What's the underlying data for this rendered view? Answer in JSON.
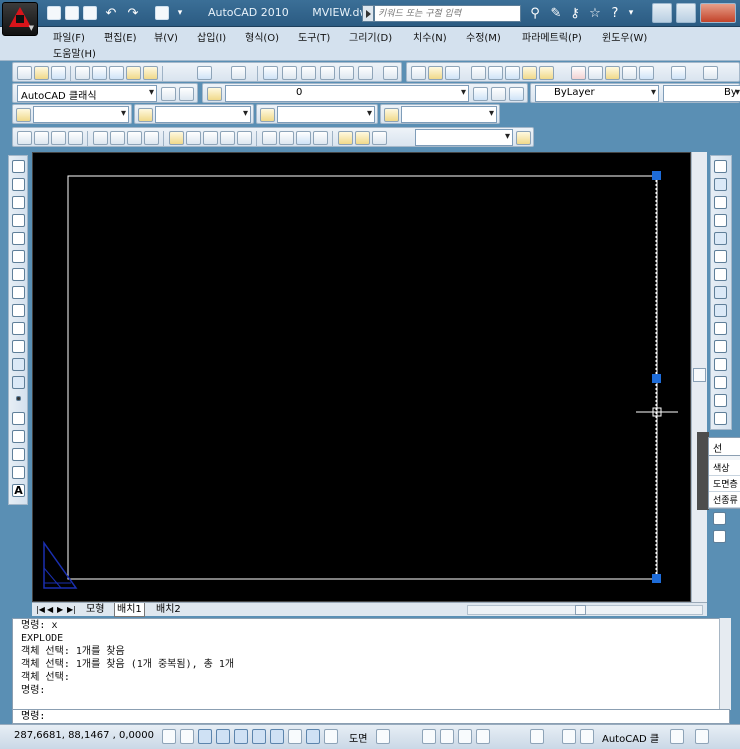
{
  "window": {
    "app_name": "AutoCAD 2010",
    "file_name": "MVIEW.dwg",
    "search_placeholder": "키워드 또는 구절 입력"
  },
  "menu": {
    "row1": [
      "파일(F)",
      "편집(E)",
      "뷰(V)",
      "삽입(I)",
      "형식(O)",
      "도구(T)",
      "그리기(D)",
      "치수(N)",
      "수정(M)",
      "파라메트릭(P)",
      "윈도우(W)"
    ],
    "row2": [
      "도움말(H)"
    ]
  },
  "toolbars": {
    "workspace": "AutoCAD 클래식",
    "layer": "0",
    "color": "ByLayer",
    "linetype": "By"
  },
  "tabs": {
    "model": "모형",
    "layout1": "배치1",
    "layout2": "배치2"
  },
  "command": {
    "history": [
      "명령: x",
      "EXPLODE",
      "객체 선택: 1개를 찾음",
      "객체 선택: 1개를 찾음 (1개 중복됨), 총 1개",
      "객체 선택:",
      "명령:"
    ],
    "prompt": "명령:"
  },
  "status": {
    "coordinates": "287,6681, 88,1467 , 0,0000",
    "paper_label": "도면",
    "workspace_label": "AutoCAD 클"
  },
  "properties_panel": {
    "title": "선",
    "rows": [
      "색상",
      "도면층",
      "선종류"
    ]
  },
  "colors": {
    "canvas": "#000000",
    "grip": "#1e6cd8",
    "ucs": "#1a2fb0",
    "viewport_border": "#ffffff"
  },
  "icons": {
    "app_menu": "autocad-logo-icon",
    "crosshair": "crosshair-cursor-icon",
    "ucs": "ucs-triangle-icon"
  }
}
